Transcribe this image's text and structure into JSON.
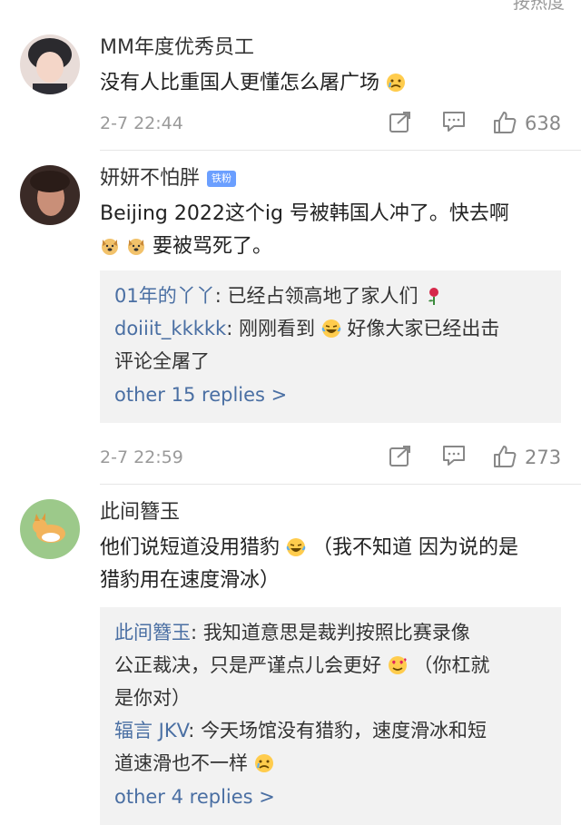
{
  "sort_label": "按热度",
  "comments": [
    {
      "username": "MM年度优秀员工",
      "text": "没有人比重国人更懂怎么屠广场",
      "text_emoji": "crying-face-emoji",
      "time": "2-7 22:44",
      "likes": "638"
    },
    {
      "username": "妍妍不怕胖",
      "badge": "铁粉",
      "text_line1": "Beijing 2022这个ig 号被韩国人冲了。快去啊",
      "text_line2": "要被骂死了。",
      "text_emoji": "dog-face-emoji",
      "replies": [
        {
          "name": "01年的丫丫",
          "text": "已经占领高地了家人们",
          "emoji": "rose-emoji"
        },
        {
          "name": "doiiit_kkkkk",
          "text_a": "刚刚看到",
          "text_b": "好像大家已经出击",
          "text_c": "评论全屠了",
          "emoji": "laughing-crying-emoji"
        }
      ],
      "more_replies": "other 15 replies >",
      "time": "2-7 22:59",
      "likes": "273"
    },
    {
      "username": "此间簪玉",
      "text_a": "他们说短道没用猎豹",
      "text_b": "（我不知道 因为说的是",
      "text_c": "猎豹用在速度滑冰）",
      "text_emoji": "laughing-crying-emoji",
      "replies": [
        {
          "name": "此间簪玉",
          "text_a": "我知道意思是裁判按照比赛录像",
          "text_b": "公正裁决，只是严谨点儿会更好",
          "text_c": "（你杠就",
          "text_d": "是你对）",
          "emoji": "heart-eyes-emoji"
        },
        {
          "name": "辐言 JKV",
          "text_a": "今天场馆没有猎豹，速度滑冰和短",
          "text_b": "道速滑也不一样",
          "emoji": "crying-face-emoji"
        }
      ],
      "more_replies": "other 4 replies >"
    }
  ],
  "icons": {
    "share": "share-icon",
    "comment": "comment-icon",
    "like": "thumbs-up-icon"
  },
  "colors": {
    "link": "#4a6fa3",
    "reply_bg": "#f2f2f2",
    "badge": "#6b9fff"
  }
}
